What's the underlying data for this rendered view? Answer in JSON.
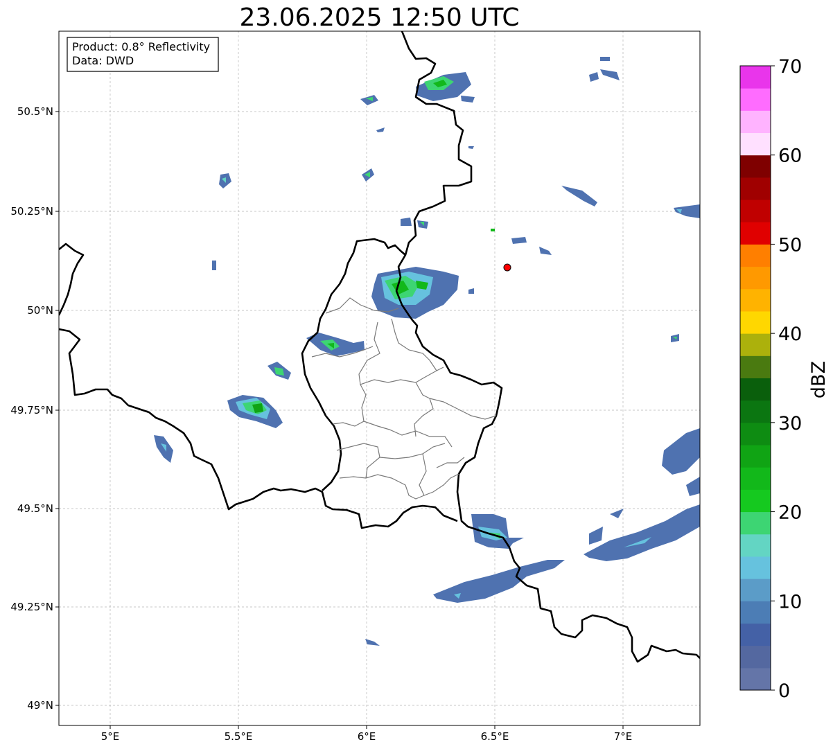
{
  "title": "23.06.2025 12:50 UTC",
  "info": {
    "product": "Product: 0.8° Reflectivity",
    "data": "Data: DWD"
  },
  "x_ticks": [
    "5°E",
    "5.5°E",
    "6°E",
    "6.5°E",
    "7°E"
  ],
  "y_ticks": [
    "50.5°N",
    "50.25°N",
    "50°N",
    "49.75°N",
    "49.5°N",
    "49.25°N",
    "49°N"
  ],
  "colorbar": {
    "label": "dBZ",
    "ticks": [
      "0",
      "10",
      "20",
      "30",
      "40",
      "50",
      "60",
      "70"
    ],
    "range": [
      0,
      70
    ],
    "bins": [
      {
        "from": 0,
        "to": 2.5,
        "color": "#6475a8"
      },
      {
        "from": 2.5,
        "to": 5,
        "color": "#5468a0"
      },
      {
        "from": 5,
        "to": 7.5,
        "color": "#4461a6"
      },
      {
        "from": 7.5,
        "to": 10,
        "color": "#4c7db5"
      },
      {
        "from": 10,
        "to": 12.5,
        "color": "#5b9cc8"
      },
      {
        "from": 12.5,
        "to": 15,
        "color": "#66c2de"
      },
      {
        "from": 15,
        "to": 17.5,
        "color": "#63d5c3"
      },
      {
        "from": 17.5,
        "to": 20,
        "color": "#3dd573"
      },
      {
        "from": 20,
        "to": 22.5,
        "color": "#15c91f"
      },
      {
        "from": 22.5,
        "to": 25,
        "color": "#12b81a"
      },
      {
        "from": 25,
        "to": 27.5,
        "color": "#10a414"
      },
      {
        "from": 27.5,
        "to": 30,
        "color": "#0e8c12"
      },
      {
        "from": 30,
        "to": 32.5,
        "color": "#0b7611"
      },
      {
        "from": 32.5,
        "to": 35,
        "color": "#0a5f0c"
      },
      {
        "from": 35,
        "to": 37.5,
        "color": "#4a7a10"
      },
      {
        "from": 37.5,
        "to": 40,
        "color": "#acb10c"
      },
      {
        "from": 40,
        "to": 42.5,
        "color": "#ffd700"
      },
      {
        "from": 42.5,
        "to": 45,
        "color": "#ffb300"
      },
      {
        "from": 45,
        "to": 47.5,
        "color": "#ff9900"
      },
      {
        "from": 47.5,
        "to": 50,
        "color": "#ff7f00"
      },
      {
        "from": 50,
        "to": 52.5,
        "color": "#e00000"
      },
      {
        "from": 52.5,
        "to": 55,
        "color": "#c00000"
      },
      {
        "from": 55,
        "to": 57.5,
        "color": "#a00000"
      },
      {
        "from": 57.5,
        "to": 60,
        "color": "#7f0000"
      },
      {
        "from": 60,
        "to": 62.5,
        "color": "#ffe0ff"
      },
      {
        "from": 62.5,
        "to": 65,
        "color": "#ffb3ff"
      },
      {
        "from": 65,
        "to": 67.5,
        "color": "#ff6cff"
      },
      {
        "from": 67.5,
        "to": 70,
        "color": "#e935eb"
      }
    ]
  },
  "marker_color": "#ff0000"
}
